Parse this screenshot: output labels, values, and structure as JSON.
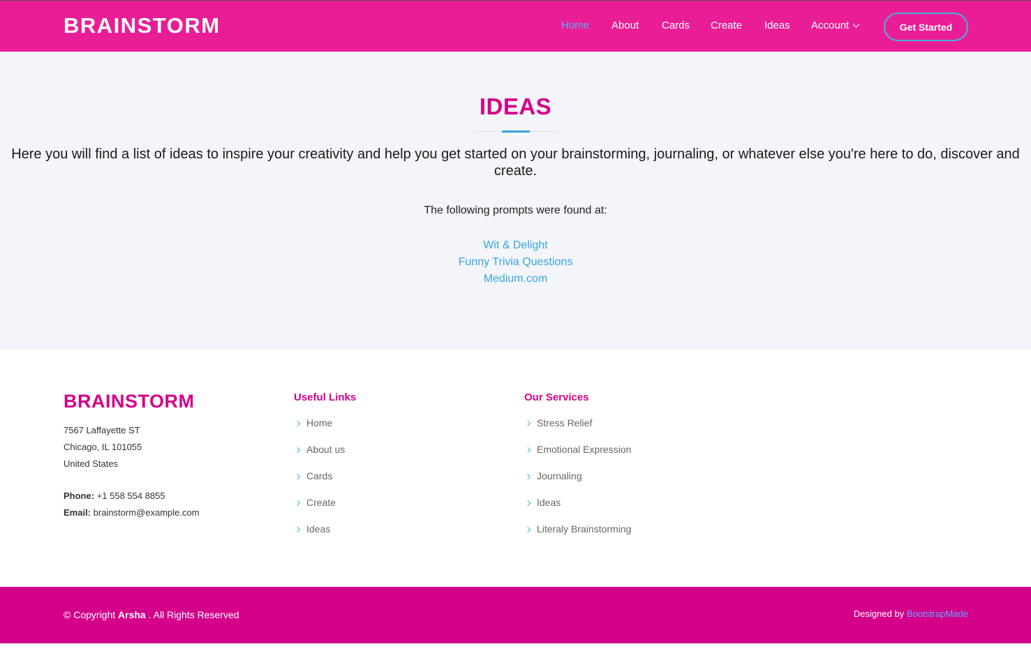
{
  "header": {
    "logo": "BRAINSTORM",
    "nav": {
      "home": "Home",
      "about": "About",
      "cards": "Cards",
      "create": "Create",
      "ideas": "Ideas",
      "account": "Account"
    },
    "cta": "Get Started"
  },
  "main": {
    "title": "IDEAS",
    "intro": "Here you will find a list of ideas to inspire your creativity and help you get started on your brainstorming, journaling, or whatever else you're here to do, discover and create.",
    "found_at": "The following prompts were found at:",
    "sources": [
      "Wit & Delight",
      "Funny Trivia Questions",
      "Medium.com"
    ]
  },
  "footer": {
    "logo": "BRAINSTORM",
    "address": [
      "7567 Laffayette ST",
      "Chicago, IL 101055",
      "United States"
    ],
    "phone_label": "Phone:",
    "phone": "+1 558 554 8855",
    "email_label": "Email:",
    "email": "brainstorm@example.com",
    "useful_links_title": "Useful Links",
    "useful_links": [
      "Home",
      "About us",
      "Cards",
      "Create",
      "Ideas"
    ],
    "services_title": "Our Services",
    "services": [
      "Stress Relief",
      "Emotional Expression",
      "Journaling",
      "Ideas",
      "Literaly Brainstorming"
    ],
    "copyright_prefix": "© Copyright",
    "copyright_brand": "Arsha",
    "copyright_suffix": ". All Rights Reserved",
    "designed_by_label": "Designed by",
    "designed_by_link": "BootstrapMade"
  },
  "colors": {
    "header_bg": "#e91e96",
    "brand_magenta": "#d4008a",
    "accent_blue": "#37a5dd",
    "active_nav": "#5aa8ff",
    "main_bg": "#f3f5fa"
  }
}
